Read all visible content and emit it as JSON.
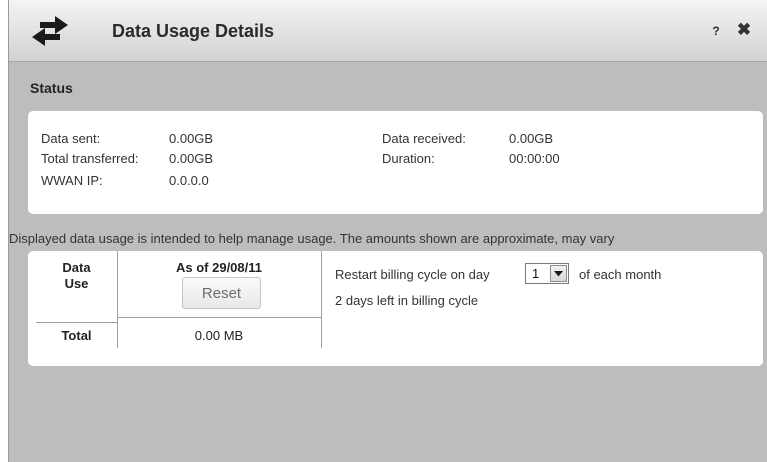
{
  "window": {
    "title": "Data Usage Details",
    "help_label": "?",
    "close_label": "✖"
  },
  "status": {
    "heading": "Status",
    "data_sent_label": "Data sent:",
    "data_sent_value": "0.00GB",
    "total_transferred_label": "Total transferred:",
    "total_transferred_value": "0.00GB",
    "wwan_ip_label": "WWAN IP:",
    "wwan_ip_value": "0.0.0.0",
    "data_received_label": "Data received:",
    "data_received_value": "0.00GB",
    "duration_label": "Duration:",
    "duration_value": "00:00:00"
  },
  "disclaimer": "Displayed data usage is intended to help manage usage. The amounts shown are approximate, may vary",
  "usage": {
    "row_header_line1": "Data",
    "row_header_line2": "Use",
    "as_of": "As of 29/08/11",
    "reset_label": "Reset",
    "total_label": "Total",
    "total_value": "0.00 MB",
    "billing_prefix": "Restart billing cycle on day",
    "billing_day": "1",
    "billing_suffix": "of each month",
    "days_left": "2 days left in billing cycle"
  },
  "colors": {
    "background": "#bdbdbd",
    "panel": "#ffffff",
    "titlebar": "#e2e2e2"
  },
  "icons": {
    "app": "swap-arrows-icon",
    "dropdown": "chevron-down-icon"
  }
}
